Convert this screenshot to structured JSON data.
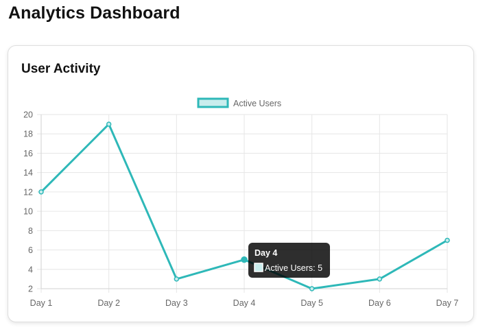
{
  "page": {
    "title": "Analytics Dashboard"
  },
  "card": {
    "title": "User Activity"
  },
  "chart_data": {
    "type": "line",
    "categories": [
      "Day 1",
      "Day 2",
      "Day 3",
      "Day 4",
      "Day 5",
      "Day 6",
      "Day 7"
    ],
    "series": [
      {
        "name": "Active Users",
        "values": [
          12,
          19,
          3,
          5,
          2,
          3,
          7
        ],
        "color": "#2eb8b8",
        "fill": "#c9eded"
      }
    ],
    "yticks": [
      "2",
      "4",
      "6",
      "8",
      "10",
      "12",
      "14",
      "16",
      "18",
      "20"
    ],
    "ylim": [
      2,
      20
    ],
    "grid": true,
    "legend": "top-center",
    "tooltip": {
      "title": "Day 4",
      "label": "Active Users: 5"
    }
  }
}
